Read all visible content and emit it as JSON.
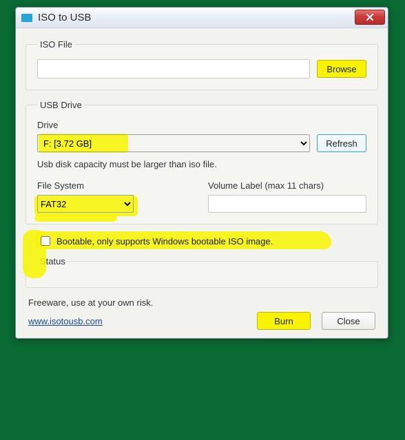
{
  "window": {
    "title": "ISO to USB"
  },
  "iso": {
    "legend": "ISO File",
    "value": "",
    "browse_label": "Browse"
  },
  "usb": {
    "legend": "USB Drive",
    "drive_label": "Drive",
    "drive_value": "F: [3.72 GB]",
    "refresh_label": "Refresh",
    "hint": "Usb disk capacity must be larger than iso file.",
    "fs_label": "File System",
    "fs_value": "FAT32",
    "vol_label": "Volume Label (max 11 chars)",
    "vol_value": ""
  },
  "bootable": {
    "checked": false,
    "label": "Bootable, only supports Windows bootable ISO image."
  },
  "status": {
    "legend": "Status"
  },
  "footer": {
    "disclaimer": "Freeware, use at your own risk.",
    "link": "www.isotousb.com",
    "burn_label": "Burn",
    "close_label": "Close"
  }
}
